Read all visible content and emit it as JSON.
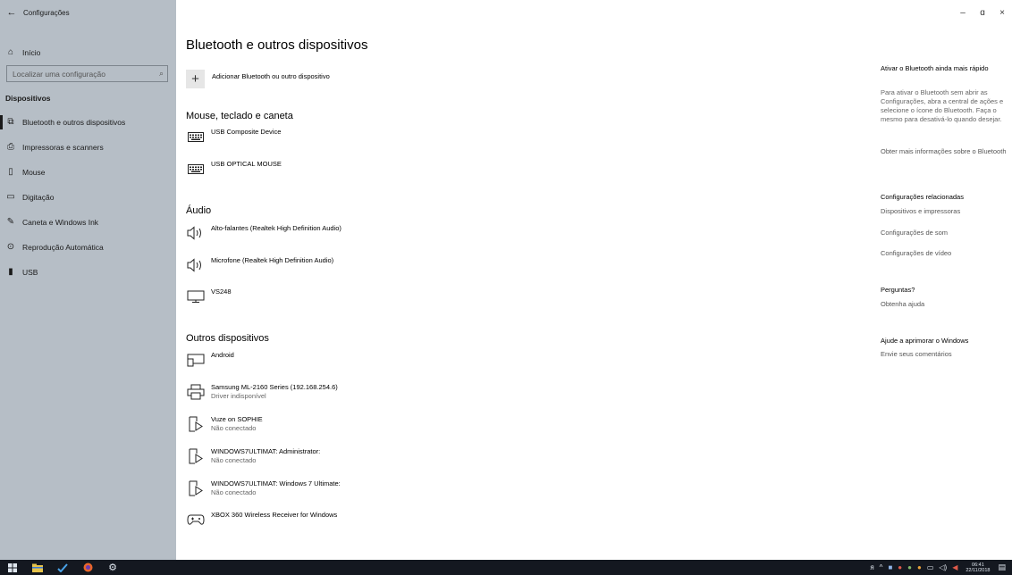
{
  "window": {
    "title": "Configurações",
    "back_icon": "←",
    "controls": {
      "minimize": "–",
      "restore": "ɑ",
      "close": "×"
    }
  },
  "sidebar": {
    "home_label": "Início",
    "search_placeholder": "Localizar uma configuração",
    "section": "Dispositivos",
    "items": [
      {
        "label": "Bluetooth e outros dispositivos",
        "icon": "bluetooth-devices-icon",
        "glyph": "⧉",
        "selected": true
      },
      {
        "label": "Impressoras e scanners",
        "icon": "printer-icon",
        "glyph": "⎙",
        "selected": false
      },
      {
        "label": "Mouse",
        "icon": "mouse-icon",
        "glyph": "▯",
        "selected": false
      },
      {
        "label": "Digitação",
        "icon": "keyboard-icon",
        "glyph": "▭",
        "selected": false
      },
      {
        "label": "Caneta e Windows Ink",
        "icon": "pen-icon",
        "glyph": "✎",
        "selected": false
      },
      {
        "label": "Reprodução Automática",
        "icon": "autoplay-icon",
        "glyph": "⊙",
        "selected": false
      },
      {
        "label": "USB",
        "icon": "usb-icon",
        "glyph": "▮",
        "selected": false
      }
    ]
  },
  "main": {
    "title": "Bluetooth e outros dispositivos",
    "add_label": "Adicionar Bluetooth ou outro dispositivo",
    "groups": {
      "mouse": "Mouse, teclado e caneta",
      "audio": "Áudio",
      "others": "Outros dispositivos"
    },
    "devices": {
      "usb_composite": {
        "name": "USB Composite Device",
        "icon": "keyboard-icon"
      },
      "usb_mouse": {
        "name": "USB OPTICAL MOUSE",
        "icon": "keyboard-icon"
      },
      "speakers": {
        "name": "Alto-falantes (Realtek High Definition Audio)",
        "icon": "speaker-icon"
      },
      "microphone": {
        "name": "Microfone (Realtek High Definition Audio)",
        "icon": "speaker-icon"
      },
      "vs248": {
        "name": "VS248",
        "icon": "monitor-icon"
      },
      "android": {
        "name": "Android",
        "icon": "phone-icon"
      },
      "samsung": {
        "name": "Samsung ML-2160 Series (192.168.254.6)",
        "status": "Driver indisponível",
        "icon": "printer-icon"
      },
      "vuze": {
        "name": "Vuze on SOPHIE",
        "status": "Não conectado",
        "icon": "media-device-icon"
      },
      "win7_admin": {
        "name": "WINDOWS7ULTIMAT: Administrator:",
        "status": "Não conectado",
        "icon": "media-device-icon"
      },
      "win7_ultimate": {
        "name": "WINDOWS7ULTIMAT: Windows 7 Ultimate:",
        "status": "Não conectado",
        "icon": "media-device-icon"
      },
      "xbox": {
        "name": "XBOX 360 Wireless Receiver for Windows",
        "icon": "gamepad-icon"
      }
    }
  },
  "right": {
    "bt_heading": "Ativar o Bluetooth ainda mais rápido",
    "bt_text": "Para ativar o Bluetooth sem abrir as Configurações, abra a central de ações e selecione o ícone do Bluetooth. Faça o mesmo para desativá-lo quando desejar.",
    "bt_link": "Obter mais informações sobre o Bluetooth",
    "related_heading": "Configurações relacionadas",
    "related_links": [
      "Dispositivos e impressoras",
      "Configurações de som",
      "Configurações de vídeo"
    ],
    "questions_heading": "Perguntas?",
    "help_link": "Obtenha ajuda",
    "improve_heading": "Ajude a aprimorar o Windows",
    "feedback_link": "Envie seus comentários"
  },
  "taskbar": {
    "time": "06:41",
    "date": "22/11/2018"
  }
}
